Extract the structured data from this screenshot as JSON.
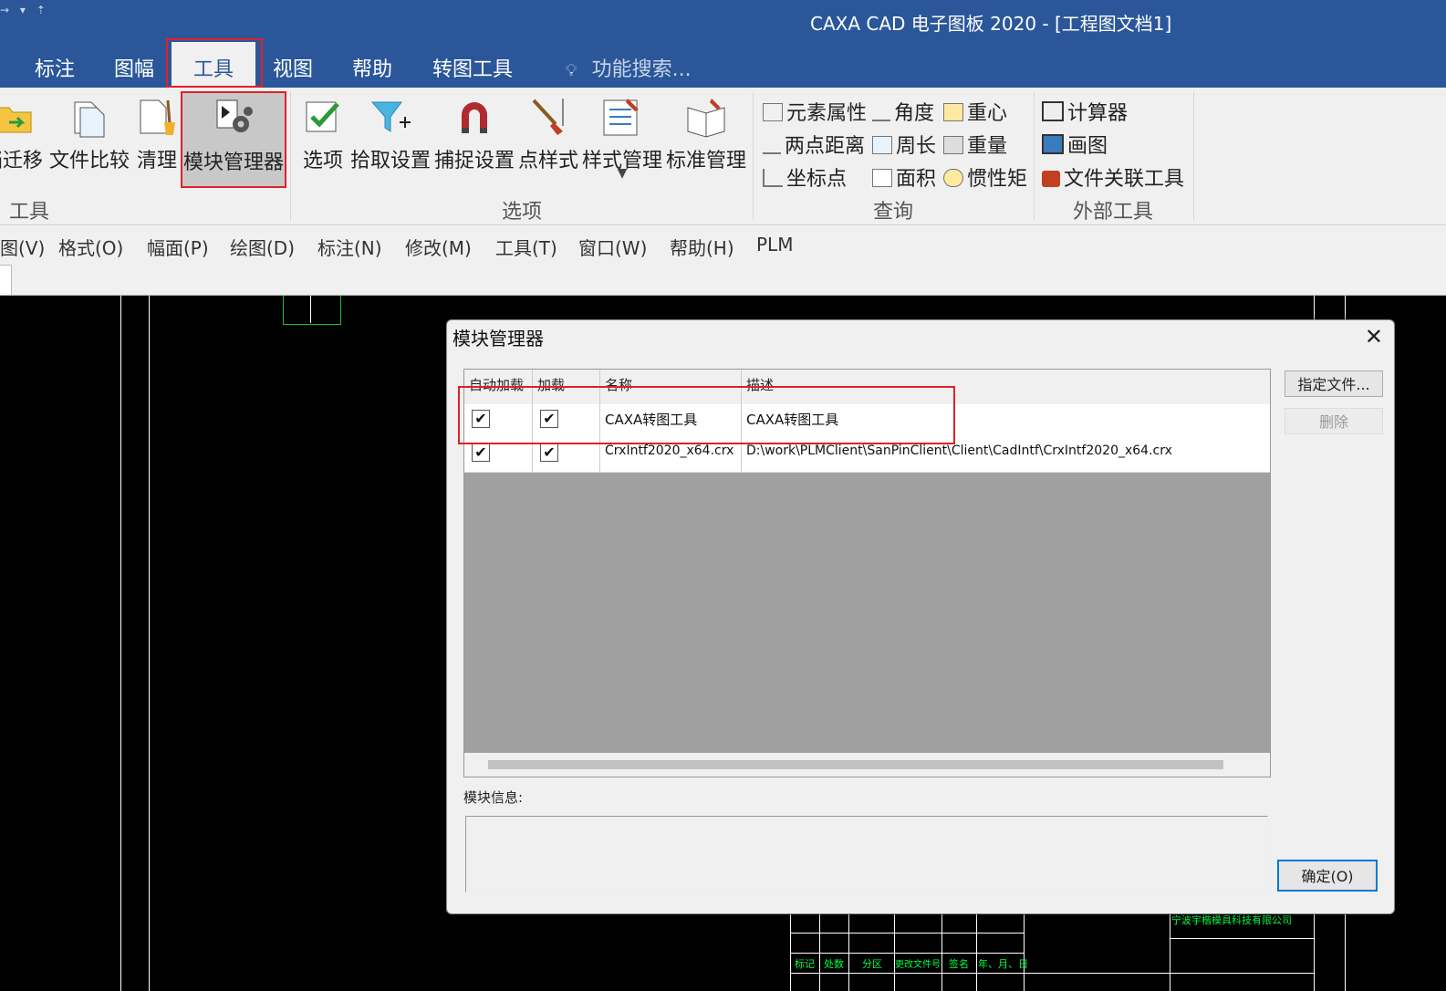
{
  "app": {
    "title": "CAXA CAD 电子图板 2020 - [工程图文档1]",
    "qat_glyphs": "→ ▾ ⇡"
  },
  "ribbon_tabs": [
    {
      "label": "标注"
    },
    {
      "label": "图幅"
    },
    {
      "label": "工具"
    },
    {
      "label": "视图"
    },
    {
      "label": "帮助"
    },
    {
      "label": "转图工具"
    }
  ],
  "search": {
    "label": "功能搜索..."
  },
  "ribbon": {
    "tools": {
      "group": "工具",
      "buttons": [
        "档迁移",
        "文件比较",
        "清理",
        "模块管理器"
      ]
    },
    "options": {
      "group": "选项",
      "buttons": [
        "选项",
        "拾取设置",
        "捕捉设置",
        "点样式",
        "样式管理",
        "标准管理"
      ]
    },
    "query": {
      "group": "查询",
      "items": [
        "元素属性",
        "角度",
        "重心",
        "两点距离",
        "周长",
        "重量",
        "坐标点",
        "面积",
        "惯性矩"
      ]
    },
    "external": {
      "group": "外部工具",
      "items": [
        "计算器",
        "画图",
        "文件关联工具"
      ]
    }
  },
  "menubar": [
    "图(V)",
    "格式(O)",
    "幅面(P)",
    "绘图(D)",
    "标注(N)",
    "修改(M)",
    "工具(T)",
    "窗口(W)",
    "帮助(H)",
    "PLM"
  ],
  "dialog": {
    "title": "模块管理器",
    "columns": [
      "自动加载",
      "加载",
      "名称",
      "描述"
    ],
    "rows": [
      {
        "auto_load": true,
        "load": true,
        "name": "CAXA转图工具",
        "desc": "CAXA转图工具"
      },
      {
        "auto_load": true,
        "load": true,
        "name": "CrxIntf2020_x64.crx",
        "desc": "D:\\work\\PLMClient\\SanPinClient\\Client\\CadIntf\\CrxIntf2020_x64.crx"
      }
    ],
    "check_glyph": "✔",
    "btn_specify": "指定文件...",
    "btn_delete": "删除",
    "info_label": "模块信息:",
    "btn_ok": "确定(O)"
  },
  "titleblock": {
    "company": "宁波宇楷模具科技有限公司",
    "headers": [
      "标记",
      "处数",
      "分区",
      "更改文件号",
      "签名",
      "年、月、日"
    ]
  },
  "colors": {
    "title_bar": "#2b579a",
    "ribbon_bg": "#f0f0f0",
    "highlight_red": "#e0202a",
    "canvas_bg": "#000000",
    "cad_green": "#00ff44",
    "selected_button": "#c8c8c8"
  }
}
